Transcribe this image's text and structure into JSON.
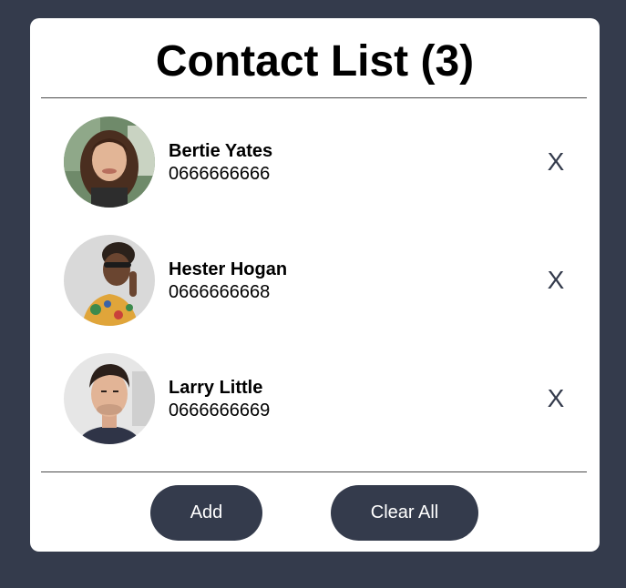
{
  "header": {
    "title": "Contact List (3)"
  },
  "contacts": [
    {
      "name": "Bertie Yates",
      "phone": "0666666666",
      "remove_label": "X"
    },
    {
      "name": "Hester Hogan",
      "phone": "0666666668",
      "remove_label": "X"
    },
    {
      "name": "Larry Little",
      "phone": "0666666669",
      "remove_label": "X"
    }
  ],
  "footer": {
    "add_label": "Add",
    "clear_label": "Clear All"
  },
  "colors": {
    "background": "#343b4c",
    "card": "#ffffff",
    "button": "#343b4c",
    "button_text": "#ffffff"
  }
}
